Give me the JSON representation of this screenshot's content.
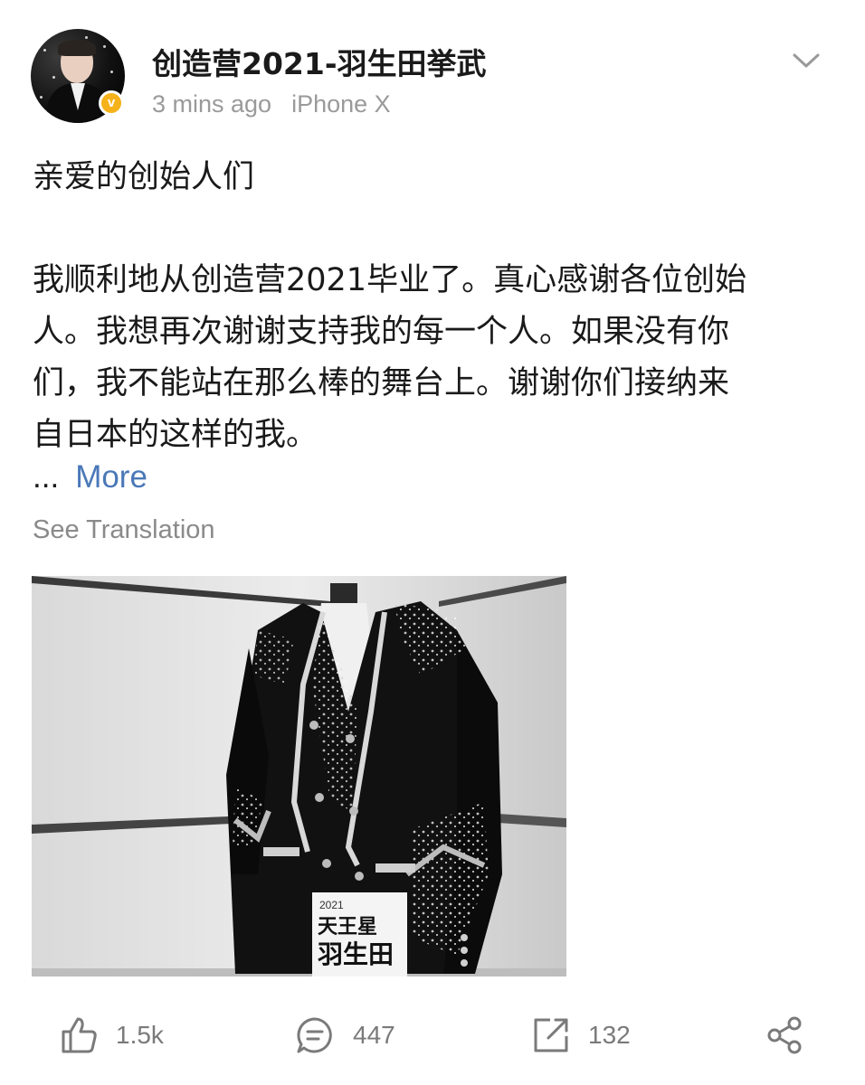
{
  "post": {
    "author": "创造营2021-羽生田挙武",
    "time": "3 mins ago",
    "device": "iPhone X",
    "paragraph1": "亲爱的创始人们",
    "paragraph2_lines": [
      "我顺利地从创造营2021毕业了。真心感谢各位创始",
      "人。我想再次谢谢支持我的每一个人。如果没有你",
      "们，我不能站在那么棒的舞台上。谢谢你们接纳来",
      "自日本的这样的我。"
    ],
    "ellipsis": "...",
    "more_label": "More",
    "see_translation": "See Translation"
  },
  "image": {
    "badge_year": "2021",
    "badge_line1": "天王星",
    "badge_line2": "羽生田"
  },
  "actions": {
    "like_count": "1.5k",
    "comment_count": "447",
    "repost_count": "132"
  },
  "icons": {
    "verified": "verified-badge-icon",
    "chevron": "chevron-down-icon",
    "like": "thumbs-up-icon",
    "comment": "comment-icon",
    "repost": "repost-icon",
    "share": "share-icon"
  },
  "colors": {
    "link": "#4a78b8",
    "verified": "#f5b21a",
    "muted": "#9a9a9a"
  }
}
